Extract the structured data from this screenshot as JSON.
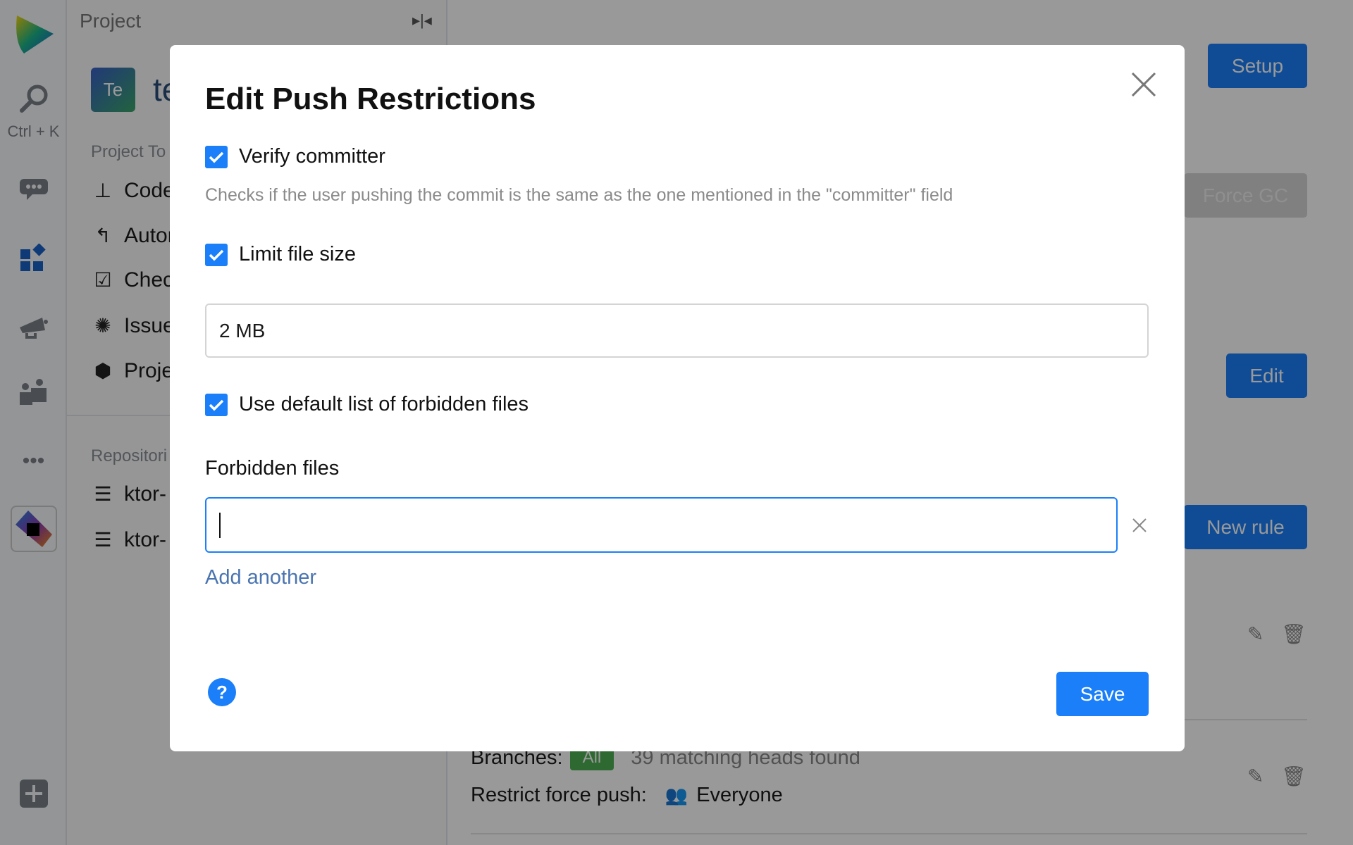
{
  "rail": {
    "search_shortcut": "Ctrl + K",
    "icons": [
      "space-logo",
      "search-icon",
      "chat-icon",
      "projects-icon",
      "megaphone-icon",
      "team-icon",
      "more-icon",
      "toolbox-app-icon",
      "plus-icon"
    ]
  },
  "panel": {
    "title": "Project",
    "avatar": "Te",
    "project_name": "te",
    "tools_heading": "Project To",
    "items": [
      "Code",
      "Autor",
      "Chec",
      "Issue",
      "Proje"
    ],
    "repos_heading": "Repositori",
    "repos": [
      "ktor-",
      "ktor-"
    ]
  },
  "main": {
    "setup": "Setup",
    "force_gc": "Force GC",
    "edit": "Edit",
    "new_rule": "New rule",
    "branches_label": "Branches:",
    "branches_badge": "All",
    "branches_info": "39 matching heads found",
    "restrict_label": "Restrict force push:",
    "restrict_value": "Everyone"
  },
  "modal": {
    "title": "Edit Push Restrictions",
    "verify_committer": {
      "label": "Verify committer",
      "checked": true,
      "hint": "Checks if the user pushing the commit is the same as the one mentioned in the \"committer\" field"
    },
    "limit_file_size": {
      "label": "Limit file size",
      "checked": true,
      "value": "2 MB"
    },
    "default_forbidden": {
      "label": "Use default list of forbidden files",
      "checked": true
    },
    "forbidden_files_label": "Forbidden files",
    "forbidden_file_value": "",
    "add_another": "Add another",
    "save": "Save"
  },
  "colors": {
    "accent": "#1a7ff8",
    "link": "#4a74b0",
    "badge_green": "#4caf50"
  }
}
